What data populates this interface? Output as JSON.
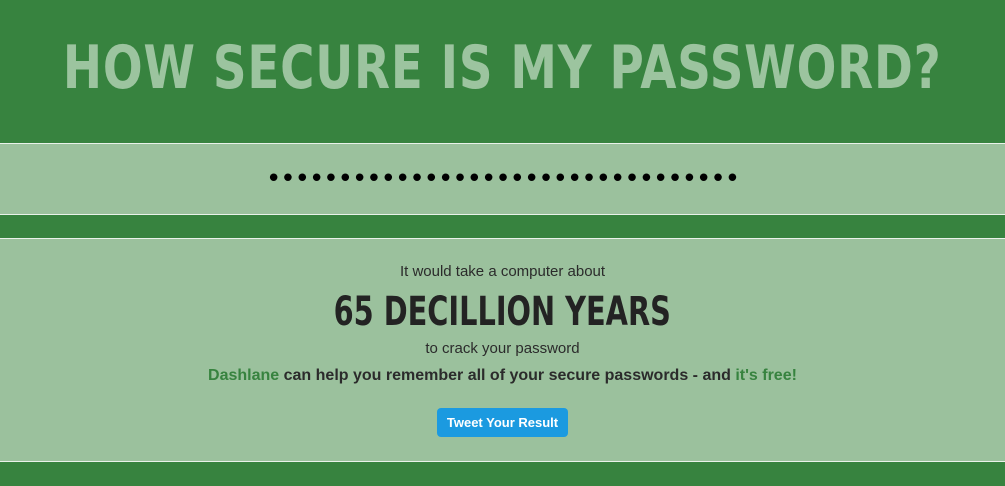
{
  "header": {
    "title": "HOW SECURE IS MY PASSWORD?"
  },
  "password": {
    "value": "mysupersecretpasswordisverylong12"
  },
  "result": {
    "lead": "It would take a computer about",
    "duration": "65 DECILLION YEARS",
    "tail": "to crack your password",
    "promo": {
      "brand_link": "Dashlane",
      "middle": " can help you remember all of your secure passwords - and ",
      "free_link": "it's free!"
    },
    "tweet_label": "Tweet Your Result"
  },
  "colors": {
    "green_dark": "#37833f",
    "green_light": "#9bc19d",
    "title_text": "#9cc49f",
    "tweet_button": "#1b9ae0"
  }
}
